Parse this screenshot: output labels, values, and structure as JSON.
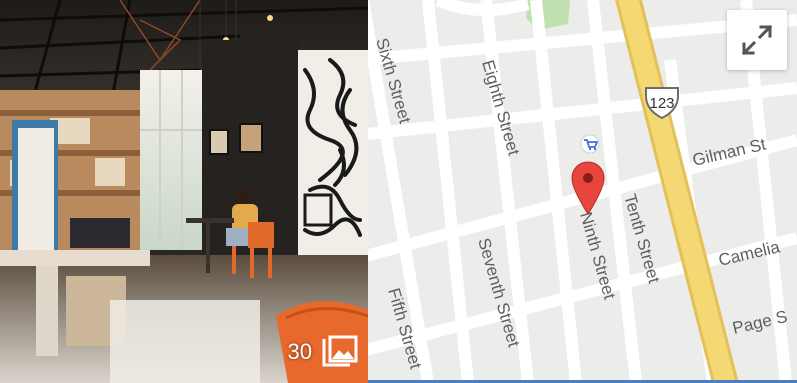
{
  "photo": {
    "count": "30",
    "gallery_icon": "image-gallery-icon"
  },
  "map": {
    "streets": {
      "sixth": "Sixth Street",
      "eighth": "Eighth Street",
      "seventh": "Seventh Street",
      "fifth": "Fifth Street",
      "ninth": "Ninth Street",
      "tenth": "Tenth Street",
      "gilman": "Gilman St",
      "camelia": "Camelia",
      "page": "Page S"
    },
    "highway_shield": "123",
    "expand_icon": "fullscreen-expand-icon",
    "marker_icon": "location-pin-icon",
    "shopping_icon": "shopping-cart-icon",
    "colors": {
      "land": "#ececea",
      "road": "#ffffff",
      "highway": "#f4d873",
      "park": "#bfe1b0",
      "pin": "#e8453c",
      "poi": "#4a6cd4"
    }
  }
}
